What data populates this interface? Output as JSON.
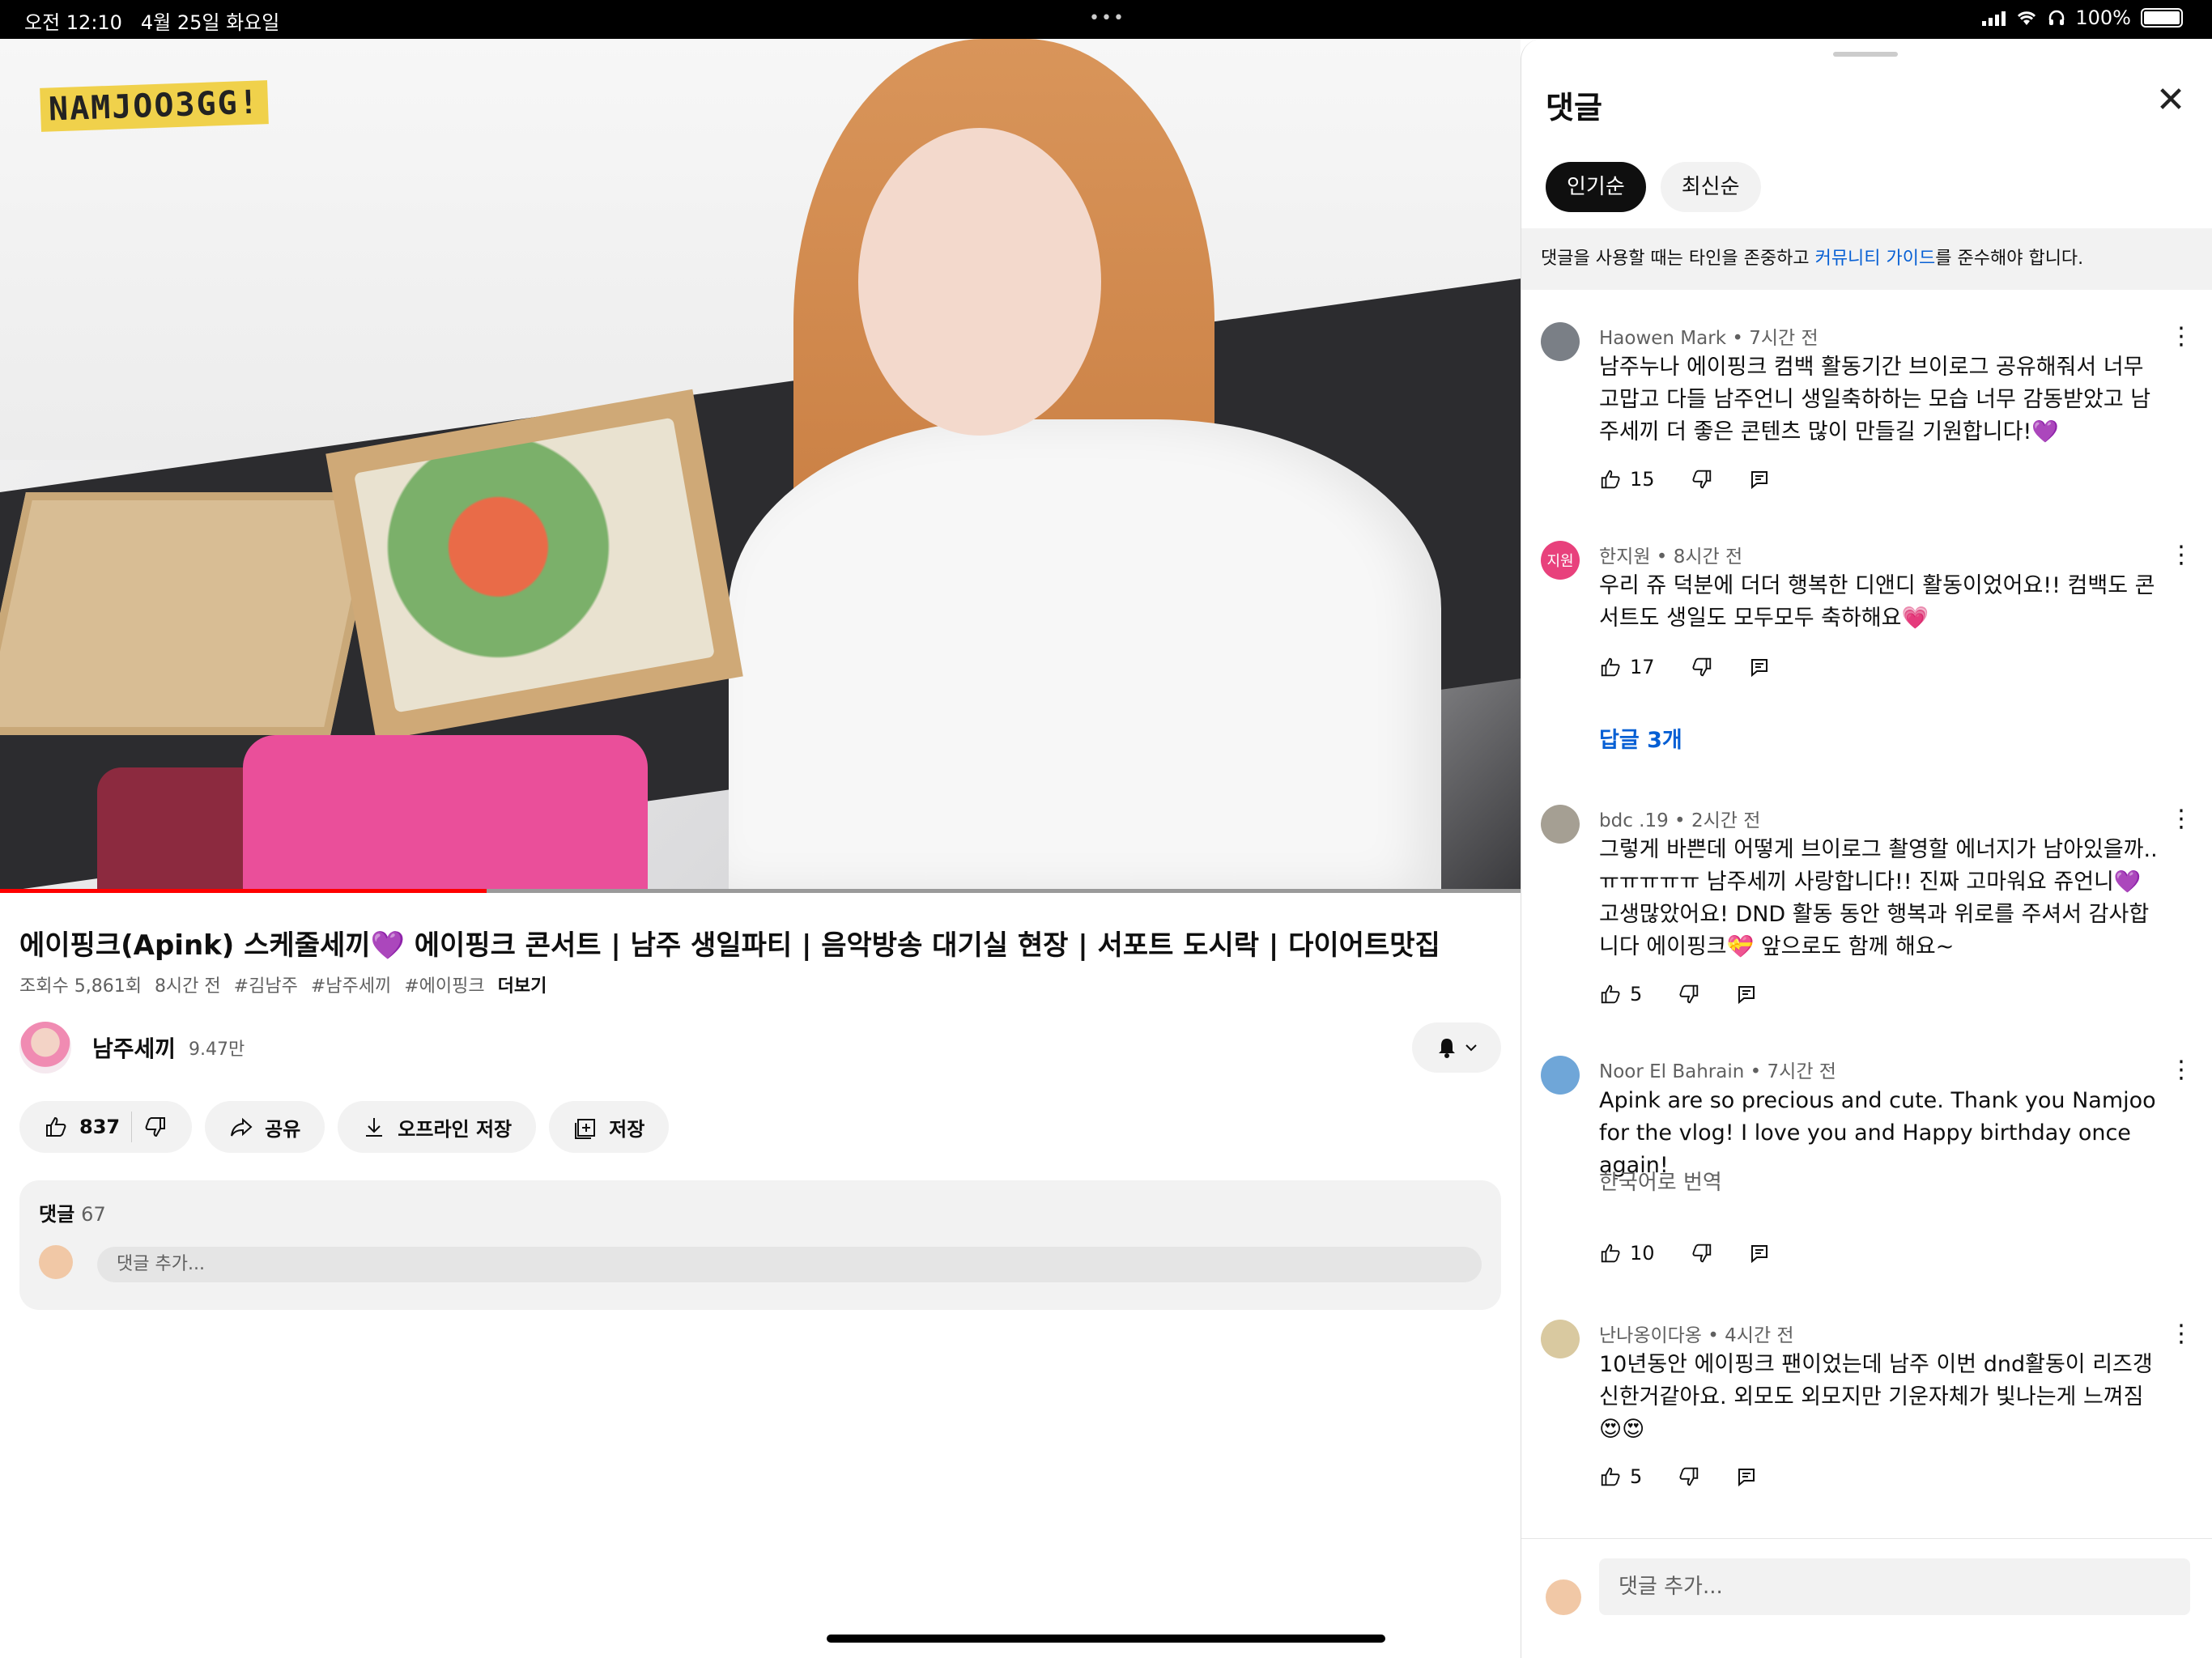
{
  "status": {
    "time": "오전 12:10",
    "date": "4월 25일 화요일",
    "dots": "•••",
    "battery": "100%"
  },
  "video": {
    "channel_logo": "NAMJOO3GG!",
    "progress_fraction": 0.32
  },
  "details": {
    "title": "에이핑크(Apink) 스케줄세끼💜 에이핑크 콘서트 | 남주 생일파티 | 음악방송 대기실 현장 | 서포트 도시락 | 다이어트맛집",
    "views": "조회수 5,861회",
    "age": "8시간 전",
    "tags": [
      "#김남주",
      "#남주세끼",
      "#에이핑크"
    ],
    "more": "더보기",
    "channel_name": "남주세끼",
    "subscribers": "9.47만"
  },
  "actions": {
    "like_count": "837",
    "share": "공유",
    "download": "오프라인 저장",
    "save": "저장"
  },
  "comments_box": {
    "title": "댓글",
    "count": "67",
    "placeholder": "댓글 추가..."
  },
  "panel": {
    "title": "댓글",
    "close": "✕",
    "chips": [
      "인기순",
      "최신순"
    ],
    "guide_prefix": "댓글을 사용할 때는 타인을 존중하고 ",
    "guide_link": "커뮤니티 가이드",
    "guide_suffix": "를 준수해야 합니다.",
    "comments": [
      {
        "author": "Haowen Mark",
        "time": "7시간 전",
        "text": "남주누나 에이핑크 컴백 활동기간 브이로그 공유해줘서 너무 고맙고 다들 남주언니 생일축하하는 모습 너무 감동받았고 남주세끼 더 좋은 콘텐츠 많이 만들길 기원합니다!💜",
        "likes": "15",
        "avatar_color": "#7a7f86",
        "avatar_text": ""
      },
      {
        "author": "한지원",
        "time": "8시간 전",
        "text": "우리 쥬 덕분에 더더 행복한 디앤디 활동이었어요!! 컴백도 콘서트도 생일도 모두모두 축하해요💗",
        "likes": "17",
        "avatar_color": "#e8417c",
        "avatar_text": "지원",
        "replies": "답글 3개"
      },
      {
        "author": "bdc .19",
        "time": "2시간 전",
        "text": "그렇게 바쁜데 어떻게 브이로그 촬영할 에너지가 남아있을까..ㅠㅠㅠㅠㅠ 남주세끼 사랑합니다!! 진짜 고마워요 쥬언니💜 고생많았어요! DND 활동 동안 행복과 위로를 주셔서 감사합니다 에이핑크💝 앞으로도 함께 해요~",
        "likes": "5",
        "avatar_color": "#a59f93",
        "avatar_text": ""
      },
      {
        "author": "Noor El Bahrain",
        "time": "7시간 전",
        "text": "Apink are so precious and cute. Thank you Namjoo for the vlog! I love you and Happy birthday once again!",
        "likes": "10",
        "avatar_color": "#6fa6d8",
        "avatar_text": "",
        "translate": "한국어로 번역"
      },
      {
        "author": "난나옹이다옹",
        "time": "4시간 전",
        "text": "10년동안 에이핑크 팬이었는데 남주 이번 dnd활동이 리즈갱신한거같아요. 외모도 외모지만 기운자체가 빛나는게 느껴짐😍😍",
        "likes": "5",
        "avatar_color": "#d9c9a0",
        "avatar_text": ""
      }
    ],
    "add_placeholder": "댓글 추가..."
  }
}
